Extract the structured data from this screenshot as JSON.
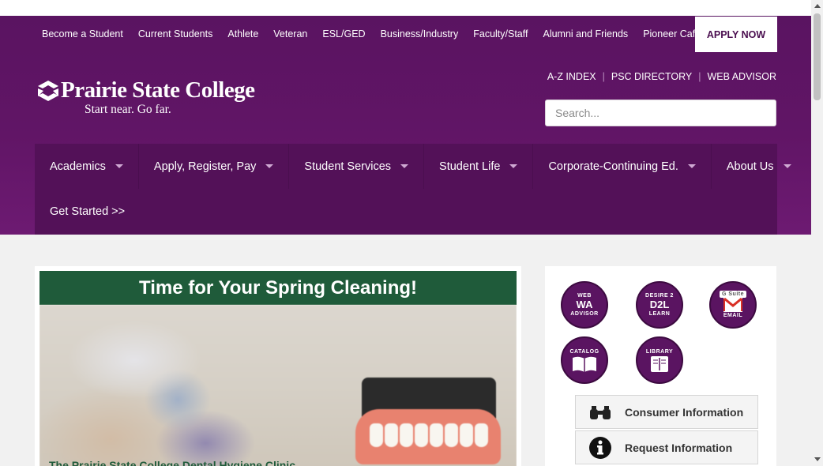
{
  "audience_nav": {
    "items": [
      "Become a Student",
      "Current Students",
      "Athlete",
      "Veteran",
      "ESL/GED",
      "Business/Industry",
      "Faculty/Staff",
      "Alumni and Friends",
      "Pioneer Café"
    ],
    "apply_label": "APPLY NOW"
  },
  "logo": {
    "name": "Prairie State College",
    "tagline": "Start near. Go far."
  },
  "util_links": [
    "A-Z INDEX",
    "PSC DIRECTORY",
    "WEB ADVISOR"
  ],
  "search": {
    "placeholder": "Search..."
  },
  "main_nav": {
    "items": [
      "Academics",
      "Apply, Register, Pay",
      "Student Services",
      "Student Life",
      "Corporate-Continuing Ed.",
      "About Us"
    ],
    "extra": "Get Started >>"
  },
  "feature": {
    "banner": "Time for Your Spring Cleaning!",
    "caption": "The Prairie State College Dental Hygiene Clinic"
  },
  "quick_links": {
    "webadvisor": {
      "top": "WEB",
      "big": "WA",
      "bottom": "ADVISOR"
    },
    "d2l": {
      "top": "DESIRE 2",
      "big": "D2L",
      "bottom": "LEARN"
    },
    "gsuite": {
      "top": "G Suite",
      "big": "M",
      "bottom": "EMAIL"
    },
    "catalog": {
      "top": "CATALOG"
    },
    "library": {
      "top": "LIBRARY"
    }
  },
  "info_buttons": [
    "Consumer Information",
    "Request Information"
  ],
  "colors": {
    "brand_purple": "#5a1461",
    "nav_purple": "#531158",
    "banner_green": "#1f5b3a"
  }
}
